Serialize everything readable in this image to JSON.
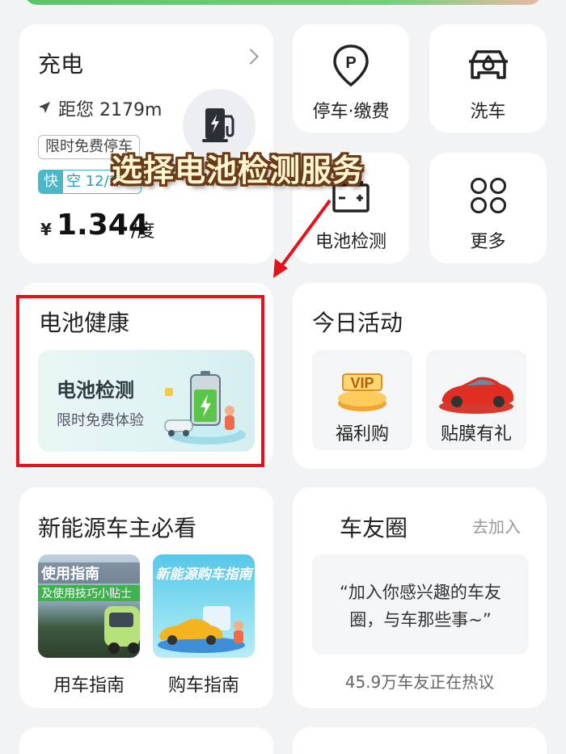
{
  "charge": {
    "title": "充电",
    "distance": "距您 2179m",
    "tag": "限时免费停车",
    "fast_key": "快",
    "fast_value": "空 12/20",
    "currency": "¥",
    "price": "1.344",
    "unit": "/度"
  },
  "services": {
    "parking": "停车·缴费",
    "wash": "洗车",
    "battery_check": "电池检测",
    "more": "更多"
  },
  "overlay": {
    "caption": "选择电池检测服务"
  },
  "battery_health": {
    "title": "电池健康",
    "banner_title": "电池检测",
    "banner_sub": "限时免费体验"
  },
  "activity": {
    "title": "今日活动",
    "items": [
      {
        "label": "福利购",
        "badge": "VIP"
      },
      {
        "label": "贴膜有礼"
      }
    ]
  },
  "guides": {
    "title": "新能源车主必看",
    "items": [
      {
        "label": "用车指南",
        "img_title": "使用指南",
        "img_sub": "及使用技巧小贴士"
      },
      {
        "label": "购车指南",
        "img_title": "新能源购车指南"
      }
    ]
  },
  "car_friends": {
    "title": "车友圈",
    "join": "去加入",
    "quote": "“加入你感兴趣的车友圈，与车那些事~”",
    "discussing": "45.9万车友正在热议"
  },
  "colors": {
    "highlight_red": "#e5121b",
    "accent_teal": "#4bb7c7",
    "caption_brown": "#6b3a16"
  }
}
